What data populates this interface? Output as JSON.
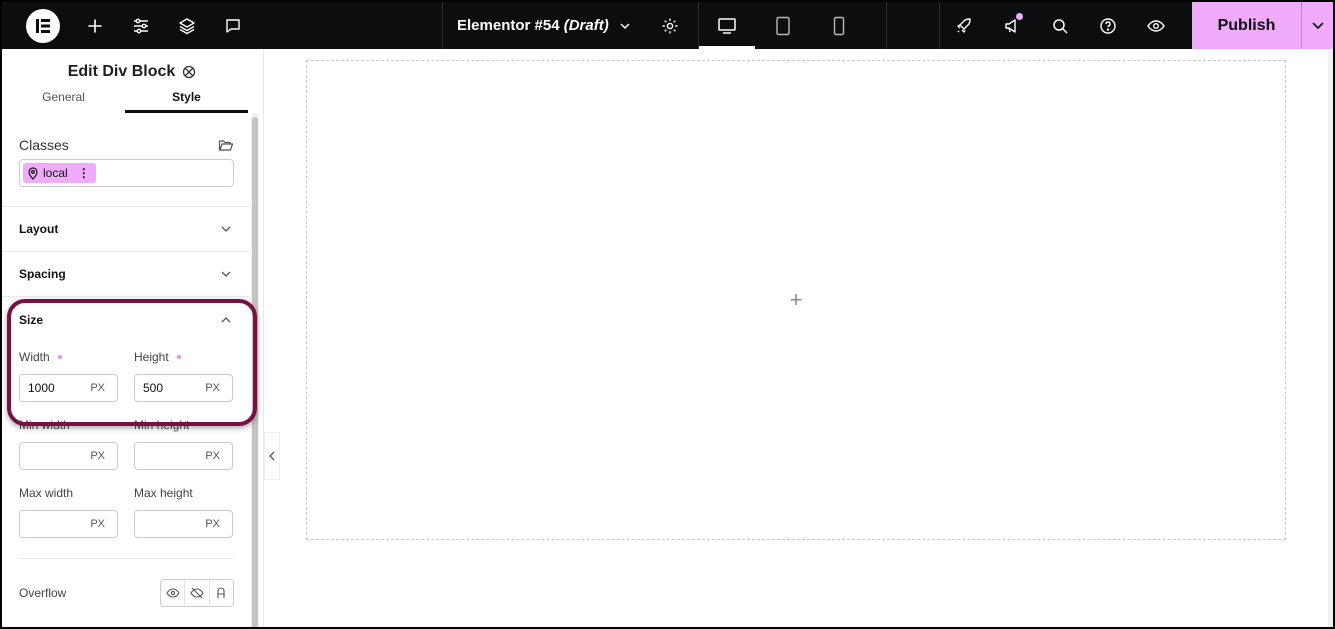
{
  "topbar": {
    "document_name": "Elementor #54",
    "document_status": "(Draft)",
    "publish_label": "Publish"
  },
  "panel": {
    "title": "Edit Div Block",
    "tabs": [
      {
        "label": "General",
        "active": false
      },
      {
        "label": "Style",
        "active": true
      }
    ],
    "classes": {
      "label": "Classes",
      "chips": [
        {
          "label": "local"
        }
      ]
    },
    "sections": {
      "layout": "Layout",
      "spacing": "Spacing",
      "size": "Size"
    },
    "size": {
      "width": {
        "label": "Width",
        "value": "1000",
        "unit": "PX"
      },
      "height": {
        "label": "Height",
        "value": "500",
        "unit": "PX"
      },
      "min_width": {
        "label": "Min width",
        "value": "",
        "unit": "PX"
      },
      "min_height": {
        "label": "Min height",
        "value": "",
        "unit": "PX"
      },
      "max_width": {
        "label": "Max width",
        "value": "",
        "unit": "PX"
      },
      "max_height": {
        "label": "Max height",
        "value": "",
        "unit": "PX"
      }
    },
    "overflow": {
      "label": "Overflow"
    }
  },
  "colors": {
    "topbar_bg": "#0c0d0e",
    "accent": "#f0abfc",
    "highlight": "#7a0f44"
  }
}
